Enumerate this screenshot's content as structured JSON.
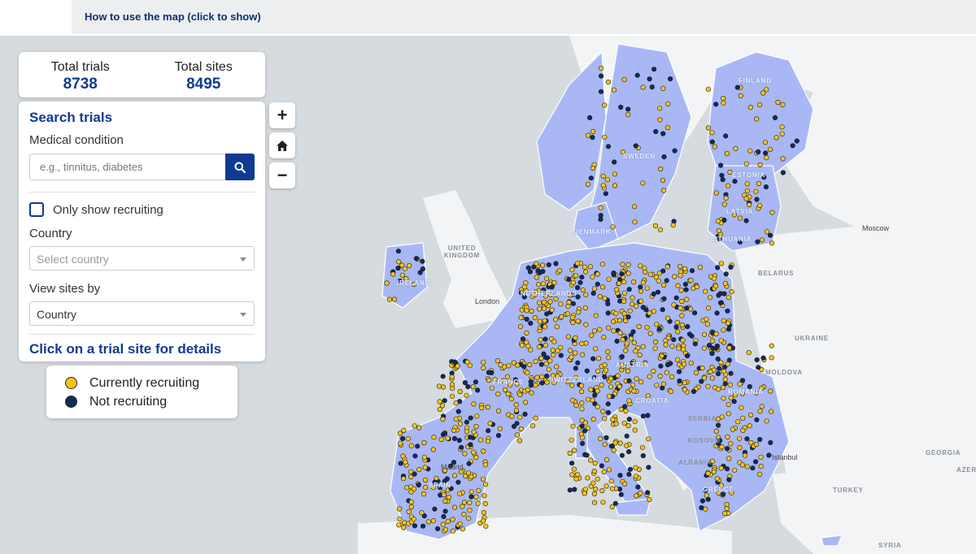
{
  "header": {
    "how_to_label": "How to use the map  (click to show)"
  },
  "stats": {
    "total_trials_label": "Total trials",
    "total_trials_value": "8738",
    "total_sites_label": "Total sites",
    "total_sites_value": "8495"
  },
  "search": {
    "title": "Search trials",
    "condition_label": "Medical condition",
    "condition_placeholder": "e.g., tinnitus, diabetes",
    "recruiting_label": "Only show recruiting",
    "country_label": "Country",
    "country_placeholder": "Select country",
    "view_by_label": "View sites by",
    "view_by_value": "Country",
    "hint": "Click on a trial site for details"
  },
  "zoom": {
    "in": "+",
    "out": "−"
  },
  "legend": {
    "recruiting_label": "Currently recruiting",
    "recruiting_color": "#f5c518",
    "not_recruiting_label": "Not recruiting",
    "not_recruiting_color": "#142a5c"
  },
  "map": {
    "eu_fill": "#a9b8f5",
    "land_fill": "#f3f4f5",
    "water_fill": "#d6dbe0",
    "labels": {
      "finland": "FINLAND",
      "sweden": "SWEDEN",
      "estonia": "ESTONIA",
      "latvia": "LATVIA",
      "lithuania": "LITHUANIA",
      "united_kingdom": "UNITED KINGDOM",
      "ireland": "IRELAND",
      "belarus": "BELARUS",
      "ukraine": "UKRAINE",
      "moldova": "MOLDOVA",
      "romania": "ROMANIA",
      "serbia": "SERBIA",
      "kosovo": "KOSOVO",
      "albania": "ALBANIA",
      "greece": "GREECE",
      "turkey": "TURKEY",
      "georgia": "GEORGIA",
      "syria": "SYRIA",
      "france": "FRANCE",
      "switzerland": "SWITZERLAND",
      "spain": "SPAIN",
      "austria": "AUSTRIA",
      "netherlands": "NETHERLANDS",
      "denmark": "DENMARK",
      "croatia": "CROATIA",
      "azer": "AZER"
    },
    "cities": {
      "moscow": "Moscow",
      "london": "London",
      "istanbul": "Istanbul",
      "madrid": "Madrid"
    }
  }
}
